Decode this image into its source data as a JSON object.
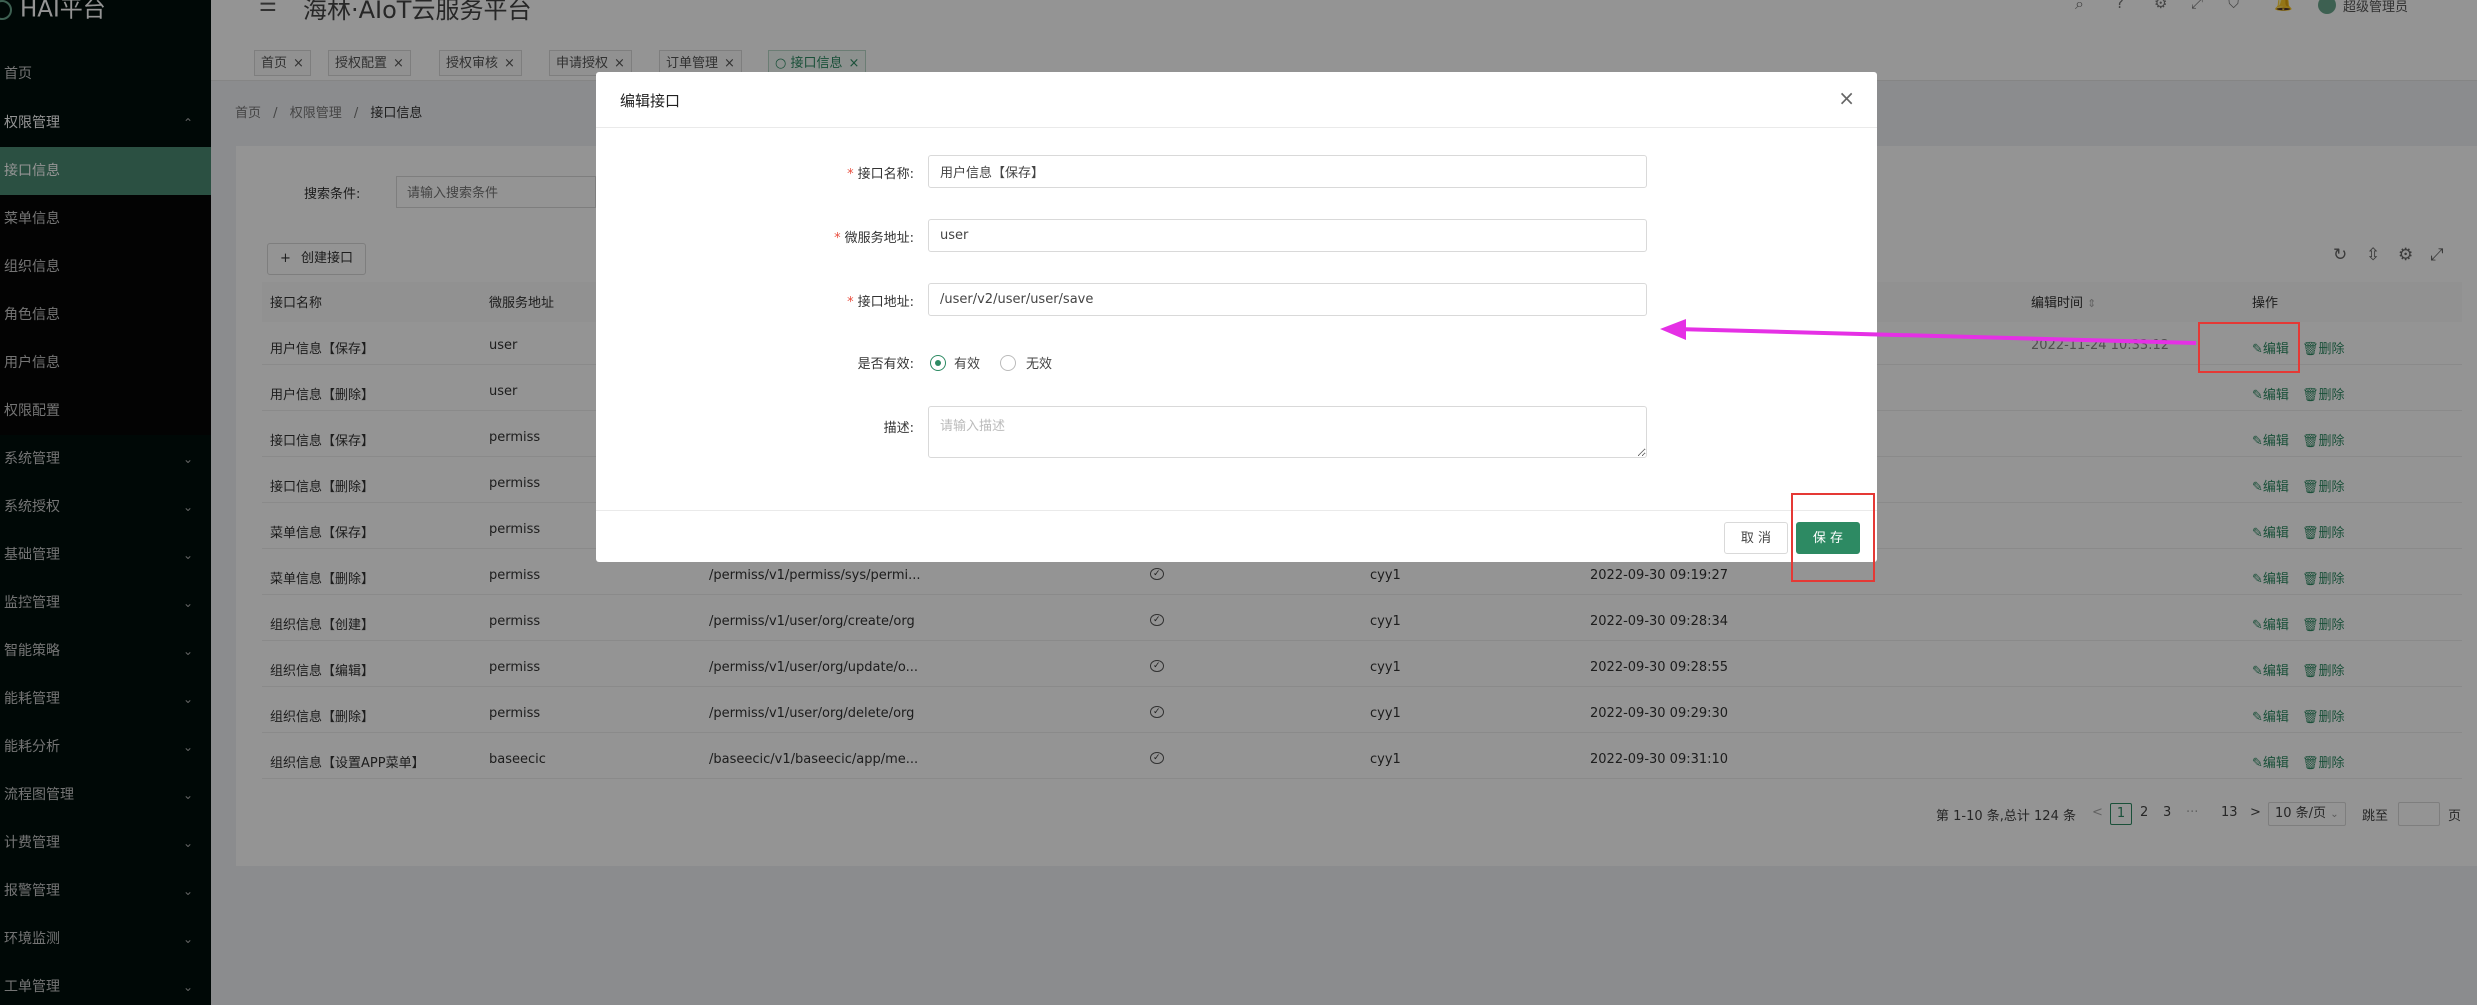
{
  "app": {
    "logo_text": "HAI平台",
    "title": "海林·AIoT云服务平台",
    "user_name": "超级管理员"
  },
  "sidebar": {
    "items": [
      {
        "label": "首页",
        "state": "plain"
      },
      {
        "label": "权限管理",
        "state": "open",
        "chevron": "⌃"
      },
      {
        "label": "接口信息",
        "state": "active"
      },
      {
        "label": "菜单信息",
        "state": "sub"
      },
      {
        "label": "组织信息",
        "state": "sub"
      },
      {
        "label": "角色信息",
        "state": "sub"
      },
      {
        "label": "用户信息",
        "state": "sub"
      },
      {
        "label": "权限配置",
        "state": "sub"
      },
      {
        "label": "系统管理",
        "state": "plain",
        "chevron": "⌄"
      },
      {
        "label": "系统授权",
        "state": "plain",
        "chevron": "⌄"
      },
      {
        "label": "基础管理",
        "state": "plain",
        "chevron": "⌄"
      },
      {
        "label": "监控管理",
        "state": "plain",
        "chevron": "⌄"
      },
      {
        "label": "智能策略",
        "state": "plain",
        "chevron": "⌄"
      },
      {
        "label": "能耗管理",
        "state": "plain",
        "chevron": "⌄"
      },
      {
        "label": "能耗分析",
        "state": "plain",
        "chevron": "⌄"
      },
      {
        "label": "流程图管理",
        "state": "plain",
        "chevron": "⌄"
      },
      {
        "label": "计费管理",
        "state": "plain",
        "chevron": "⌄"
      },
      {
        "label": "报警管理",
        "state": "plain",
        "chevron": "⌄"
      },
      {
        "label": "环境监测",
        "state": "plain",
        "chevron": "⌄"
      },
      {
        "label": "工单管理",
        "state": "plain",
        "chevron": "⌄"
      }
    ]
  },
  "tabs": [
    {
      "label": "首页",
      "close": "×",
      "active": false
    },
    {
      "label": "授权配置",
      "close": "×",
      "active": false
    },
    {
      "label": "授权审核",
      "close": "×",
      "active": false
    },
    {
      "label": "申请授权",
      "close": "×",
      "active": false
    },
    {
      "label": "订单管理",
      "close": "×",
      "active": false
    },
    {
      "label": "接口信息",
      "close": "×",
      "active": true
    }
  ],
  "breadcrumb": {
    "items": [
      "首页",
      "权限管理",
      "接口信息"
    ],
    "separator": "/"
  },
  "search": {
    "label": "搜索条件:",
    "placeholder": "请输入搜索条件"
  },
  "toolbar": {
    "create_label": "创建接口",
    "create_icon": "+"
  },
  "table": {
    "headers": [
      "接口名称",
      "微服务地址",
      "编辑时间",
      "操作"
    ],
    "sort_icon": "⇕",
    "edit_label": "编辑",
    "delete_label": "删除",
    "rows": [
      {
        "name": "用户信息【保存】",
        "service": "user",
        "path": "",
        "status": "",
        "editor": "",
        "time": "2022-11-24 10:33:12"
      },
      {
        "name": "用户信息【删除】",
        "service": "user",
        "path": "",
        "status": "",
        "editor": "",
        "time": ""
      },
      {
        "name": "接口信息【保存】",
        "service": "permiss",
        "path": "",
        "status": "",
        "editor": "",
        "time": ""
      },
      {
        "name": "接口信息【删除】",
        "service": "permiss",
        "path": "",
        "status": "",
        "editor": "",
        "time": ""
      },
      {
        "name": "菜单信息【保存】",
        "service": "permiss",
        "path": "",
        "status": "",
        "editor": "",
        "time": ""
      },
      {
        "name": "菜单信息【删除】",
        "service": "permiss",
        "path": "/permiss/v1/permiss/sys/permi...",
        "status": "✓",
        "editor": "cyy1",
        "time": "2022-09-30 09:19:27"
      },
      {
        "name": "组织信息【创建】",
        "service": "permiss",
        "path": "/permiss/v1/user/org/create/org",
        "status": "✓",
        "editor": "cyy1",
        "time": "2022-09-30 09:28:34"
      },
      {
        "name": "组织信息【编辑】",
        "service": "permiss",
        "path": "/permiss/v1/user/org/update/o...",
        "status": "✓",
        "editor": "cyy1",
        "time": "2022-09-30 09:28:55"
      },
      {
        "name": "组织信息【删除】",
        "service": "permiss",
        "path": "/permiss/v1/user/org/delete/org",
        "status": "✓",
        "editor": "cyy1",
        "time": "2022-09-30 09:29:30"
      },
      {
        "name": "组织信息【设置APP菜单】",
        "service": "baseecic",
        "path": "/baseecic/v1/baseecic/app/me...",
        "status": "✓",
        "editor": "cyy1",
        "time": "2022-09-30 09:31:10"
      }
    ]
  },
  "pagination": {
    "summary": "第 1-10 条,总计 124 条",
    "pages": [
      "1",
      "2",
      "3",
      "···",
      "13"
    ],
    "current_page": "1",
    "prev": "<",
    "next": ">",
    "page_size": "10 条/页",
    "jump_label": "跳至",
    "jump_suffix": "页"
  },
  "modal": {
    "title": "编辑接口",
    "close": "×",
    "required_mark": "*",
    "fields": {
      "name": {
        "label": "接口名称:",
        "value": "用户信息【保存】"
      },
      "service": {
        "label": "微服务地址:",
        "value": "user"
      },
      "path": {
        "label": "接口地址:",
        "value": "/user/v2/user/user/save"
      },
      "valid": {
        "label": "是否有效:",
        "options": [
          "有效",
          "无效"
        ],
        "selected": "有效"
      },
      "desc": {
        "label": "描述:",
        "placeholder": "请输入描述"
      }
    },
    "cancel_label": "取 消",
    "save_label": "保 存"
  },
  "annotation": {
    "arrow_color": "#e530e5",
    "box_color": "#e53935"
  }
}
